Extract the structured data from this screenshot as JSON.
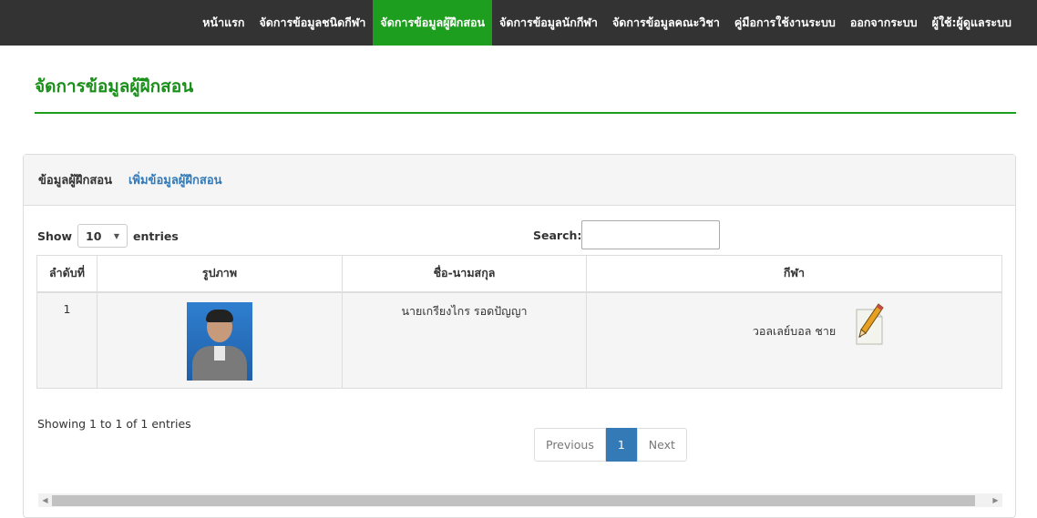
{
  "nav": {
    "items": [
      {
        "label": "หน้าแรก"
      },
      {
        "label": "จัดการข้อมูลชนิดกีฬา"
      },
      {
        "label": "จัดการข้อมูลผู้ฝึกสอน",
        "active": true
      },
      {
        "label": "จัดการข้อมูลนักกีฬา"
      },
      {
        "label": "จัดการข้อมูลคณะวิชา"
      },
      {
        "label": "คู่มือการใช้งานระบบ"
      },
      {
        "label": "ออกจากระบบ"
      },
      {
        "label": "ผู้ใช้:ผู้ดูแลระบบ"
      }
    ]
  },
  "page": {
    "title": "จัดการข้อมูลผู้ฝึกสอน"
  },
  "panel": {
    "heading": "ข้อมูลผู้ฝึกสอน",
    "add_link": "เพิ่มข้อมูลผู้ฝึกสอน"
  },
  "table_controls": {
    "show_label": "Show",
    "entries_value": "10",
    "entries_label": "entries",
    "search_label": "Search:",
    "search_value": ""
  },
  "table": {
    "headers": [
      "ลำดับที่",
      "รูปภาพ",
      "ชื่อ-นามสกุล",
      "กีฬา"
    ],
    "rows": [
      {
        "no": "1",
        "name": "นายเกรียงไกร รอดปัญญา",
        "sport": "วอลเลย์บอล ชาย"
      }
    ]
  },
  "footer": {
    "info": "Showing 1 to 1 of 1 entries",
    "prev": "Previous",
    "page": "1",
    "next": "Next"
  },
  "colors": {
    "accent": "#1e9e1e",
    "nav_bg": "#333333",
    "link": "#337ab7"
  },
  "icons": [
    "pencil-edit-icon",
    "scroll-left-icon",
    "scroll-right-icon",
    "dropdown-caret-icon"
  ]
}
